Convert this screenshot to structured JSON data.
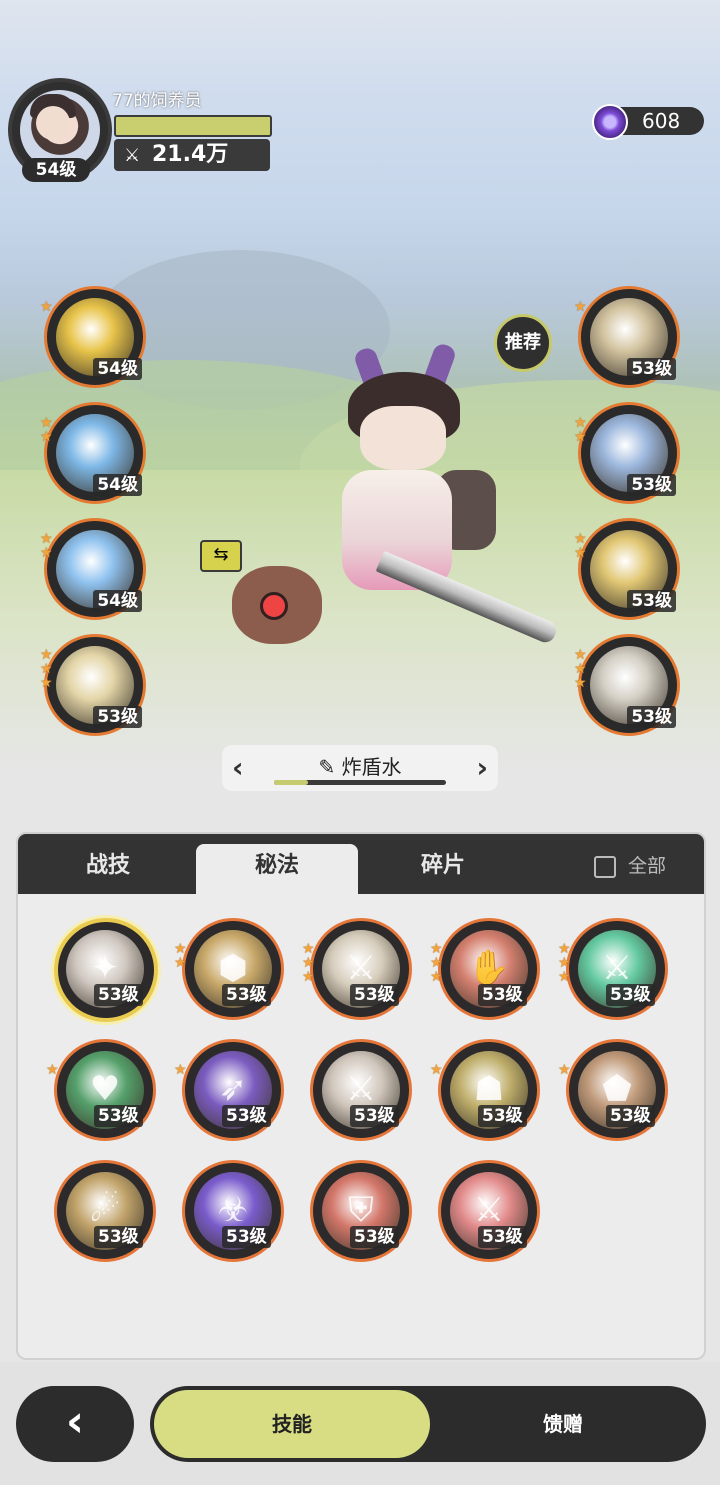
{
  "player": {
    "name": "77的饲养员",
    "level": "54级",
    "power": "21.4万",
    "xp_fraction": 1.0
  },
  "currency": {
    "icon": "purple-gem-icon",
    "value": "608"
  },
  "left_skills": [
    {
      "name": "golden-crest-skill",
      "level": "54级",
      "stars": 1,
      "color": "#e8c44a"
    },
    {
      "name": "ice-ring-skill",
      "level": "54级",
      "stars": 2,
      "color": "#7db7e6"
    },
    {
      "name": "ice-shard-skill",
      "level": "54级",
      "stars": 2,
      "color": "#8fc2ef"
    },
    {
      "name": "explosion-skill",
      "level": "53级",
      "stars": 3,
      "color": "#e4d6a8"
    }
  ],
  "right_skills": [
    {
      "name": "claw-skill",
      "level": "53级",
      "stars": 1,
      "color": "#d3c4a0"
    },
    {
      "name": "shield-skill",
      "level": "53级",
      "stars": 2,
      "color": "#9cb7dd"
    },
    {
      "name": "eye-skill",
      "level": "53级",
      "stars": 2,
      "color": "#e1c774"
    },
    {
      "name": "vortex-skill",
      "level": "53级",
      "stars": 3,
      "color": "#d5d0c6"
    }
  ],
  "recommend_label": "推荐",
  "build": {
    "name": "炸盾水",
    "progress": 0.2
  },
  "tabs": {
    "combat": "战技",
    "secret": "秘法",
    "shards": "碎片",
    "all": "全部"
  },
  "secret_skills": [
    {
      "level": "53级",
      "stars": 0,
      "color": "#cfc7bf",
      "glyph": "✦",
      "selected": true
    },
    {
      "level": "53级",
      "stars": 2,
      "color": "#c9a96a",
      "glyph": "⬢"
    },
    {
      "level": "53级",
      "stars": 3,
      "color": "#d6ccbb",
      "glyph": "⚔"
    },
    {
      "level": "53级",
      "stars": 3,
      "color": "#d4806f",
      "glyph": "✋"
    },
    {
      "level": "53级",
      "stars": 3,
      "color": "#63c9a0",
      "glyph": "⚔"
    },
    {
      "level": "53级",
      "stars": 1,
      "color": "#55a06b",
      "glyph": "♥"
    },
    {
      "level": "53级",
      "stars": 1,
      "color": "#7b5cc0",
      "glyph": "➶"
    },
    {
      "level": "53级",
      "stars": 0,
      "color": "#d0c6bc",
      "glyph": "⚔"
    },
    {
      "level": "53级",
      "stars": 1,
      "color": "#bfae6b",
      "glyph": "☗"
    },
    {
      "level": "53级",
      "stars": 1,
      "color": "#c09a7a",
      "glyph": "⬟"
    },
    {
      "level": "53级",
      "stars": 0,
      "color": "#c1a36a",
      "glyph": "☄"
    },
    {
      "level": "53级",
      "stars": 0,
      "color": "#7a5ccc",
      "glyph": "☣"
    },
    {
      "level": "53级",
      "stars": 0,
      "color": "#d3776a",
      "glyph": "⛨"
    },
    {
      "level": "53级",
      "stars": 0,
      "color": "#e28a8a",
      "glyph": "⚔"
    }
  ],
  "nav": {
    "back": "‹",
    "skill": "技能",
    "gift": "馈赠"
  }
}
